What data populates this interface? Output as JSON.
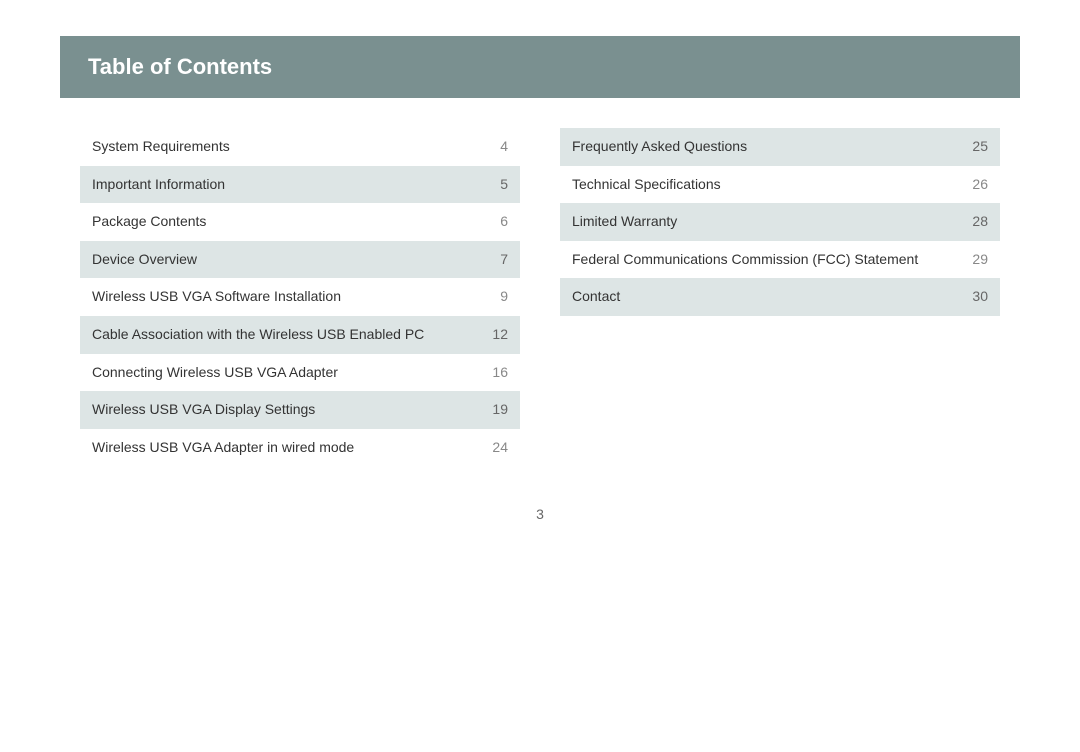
{
  "header": {
    "title": "Table of Contents"
  },
  "left_column": {
    "items": [
      {
        "title": "System Requirements",
        "page": "4",
        "highlighted": false
      },
      {
        "title": "Important Information",
        "page": "5",
        "highlighted": true
      },
      {
        "title": "Package Contents",
        "page": "6",
        "highlighted": false
      },
      {
        "title": "Device Overview",
        "page": "7",
        "highlighted": true
      },
      {
        "title": "Wireless USB VGA Software Installation",
        "page": "9",
        "highlighted": false
      },
      {
        "title": "Cable Association with the Wireless USB Enabled PC",
        "page": "12",
        "highlighted": true
      },
      {
        "title": "Connecting Wireless USB VGA Adapter",
        "page": "16",
        "highlighted": false
      },
      {
        "title": "Wireless USB VGA Display Settings",
        "page": "19",
        "highlighted": true
      },
      {
        "title": "Wireless USB VGA Adapter in wired mode",
        "page": "24",
        "highlighted": false
      }
    ]
  },
  "right_column": {
    "items": [
      {
        "title": "Frequently Asked Questions",
        "page": "25",
        "highlighted": true
      },
      {
        "title": "Technical Specifications",
        "page": "26",
        "highlighted": false
      },
      {
        "title": "Limited Warranty",
        "page": "28",
        "highlighted": true
      },
      {
        "title": "Federal Communications Commission (FCC) Statement",
        "page": "29",
        "highlighted": false
      },
      {
        "title": "Contact",
        "page": "30",
        "highlighted": true
      }
    ]
  },
  "page_number": "3"
}
